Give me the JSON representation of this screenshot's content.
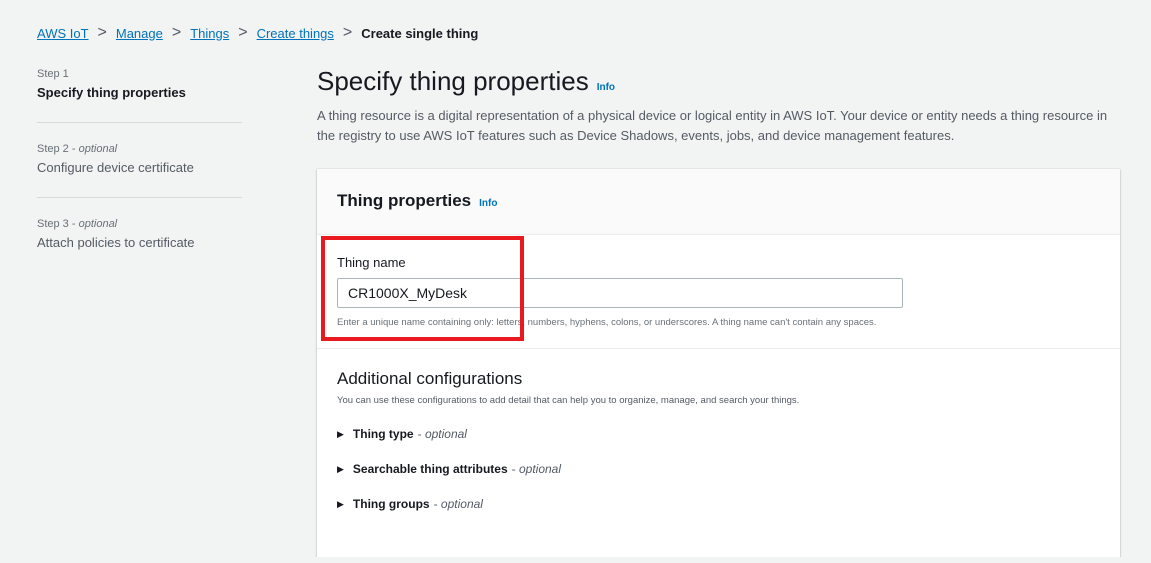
{
  "breadcrumb": {
    "items": [
      "AWS IoT",
      "Manage",
      "Things",
      "Create things"
    ],
    "current": "Create single thing",
    "separator": ">"
  },
  "steps": [
    {
      "num": "Step 1",
      "optional": "",
      "title": "Specify thing properties",
      "active": true
    },
    {
      "num": "Step 2",
      "optional": "optional",
      "title": "Configure device certificate",
      "active": false
    },
    {
      "num": "Step 3",
      "optional": "optional",
      "title": "Attach policies to certificate",
      "active": false
    }
  ],
  "main": {
    "title": "Specify thing properties",
    "info": "Info",
    "description": "A thing resource is a digital representation of a physical device or logical entity in AWS IoT. Your device or entity needs a thing resource in the registry to use AWS IoT features such as Device Shadows, events, jobs, and device management features."
  },
  "panel": {
    "title": "Thing properties",
    "info": "Info",
    "field_label": "Thing name",
    "field_value": "CR1000X_MyDesk",
    "field_hint": "Enter a unique name containing only: letters, numbers, hyphens, colons, or underscores. A thing name can't contain any spaces.",
    "additional_title": "Additional configurations",
    "additional_desc": "You can use these configurations to add detail that can help you to organize, manage, and search your things.",
    "expanders": [
      {
        "label": "Thing type",
        "optional": "optional"
      },
      {
        "label": "Searchable thing attributes",
        "optional": "optional"
      },
      {
        "label": "Thing groups",
        "optional": "optional"
      }
    ]
  },
  "colors": {
    "link": "#0073bb",
    "highlight": "#e8191f"
  },
  "icons": {
    "expand": "caret-right-icon",
    "separator": "chevron-right-icon"
  }
}
